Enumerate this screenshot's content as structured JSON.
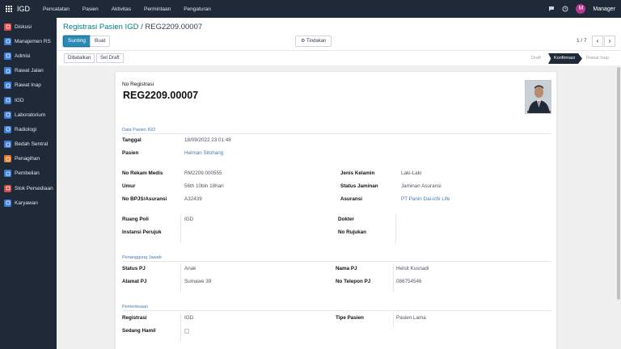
{
  "topbar": {
    "brand": "IGD",
    "menu": [
      "Pencatatan",
      "Pasien",
      "Aktivitas",
      "Permintaan",
      "Pengaturan"
    ],
    "user_initial": "M",
    "user_name": "Manager"
  },
  "sidebar": {
    "items": [
      {
        "label": "Diskusi",
        "icon": "chat-icon",
        "color": "#e14d4d"
      },
      {
        "label": "Manajemen RS",
        "icon": "hospital-icon",
        "color": "#3b7dd8"
      },
      {
        "label": "Admisi",
        "icon": "admission-icon",
        "color": "#3b7dd8"
      },
      {
        "label": "Rawat Jalan",
        "icon": "outpatient-icon",
        "color": "#3b7dd8"
      },
      {
        "label": "Rawat Inap",
        "icon": "bed-icon",
        "color": "#3b7dd8"
      },
      {
        "label": "IGD",
        "icon": "emergency-icon",
        "color": "#3b7dd8"
      },
      {
        "label": "Laboratorium",
        "icon": "lab-icon",
        "color": "#3b7dd8"
      },
      {
        "label": "Radiologi",
        "icon": "radiology-icon",
        "color": "#3b7dd8"
      },
      {
        "label": "Bedah Sentral",
        "icon": "surgery-icon",
        "color": "#3b7dd8"
      },
      {
        "label": "Penagihan",
        "icon": "invoice-icon",
        "color": "#e07b2e"
      },
      {
        "label": "Pembelian",
        "icon": "purchase-icon",
        "color": "#3b7dd8"
      },
      {
        "label": "Stok Persediaan",
        "icon": "stock-icon",
        "color": "#c84a4a"
      },
      {
        "label": "Karyawan",
        "icon": "employees-icon",
        "color": "#3b7dd8"
      }
    ]
  },
  "control": {
    "breadcrumb_parent": "Registrasi Pasien IGD",
    "breadcrumb_sep": " / ",
    "breadcrumb_current": "REG2209.00007",
    "edit_label": "Sunting",
    "create_label": "Buat",
    "action_label": "Tindakan",
    "pager": "1 / 7"
  },
  "statusbar": {
    "cancel_label": "Dibatalkan",
    "draft_btn_label": "Set Draft",
    "stages": [
      "Draft",
      "Konfirmasi",
      "Rawat Inap"
    ],
    "active_stage": "Konfirmasi"
  },
  "form": {
    "no_reg_label": "No Registrasi",
    "no_reg_value": "REG2209.00007",
    "section_patient": "Data Pasien IGD",
    "tanggal_label": "Tanggal",
    "tanggal_value": "18/09/2022 23:01:48",
    "pasien_label": "Pasien",
    "pasien_value": "Helman Sitohang",
    "rekam_medis_label": "No Rekam Medis",
    "rekam_medis_value": "RM2209.000555",
    "umur_label": "Umur",
    "umur_value": "56th 10bln 18hari",
    "bpjs_label": "No BPJS/Asuransi",
    "bpjs_value": "A32439",
    "jk_label": "Jenis Kelamin",
    "jk_value": "Laki-Laki",
    "jaminan_label": "Status Jaminan",
    "jaminan_value": "Jaminan Asuransi",
    "asuransi_label": "Asuransi",
    "asuransi_value": "PT Panin Dai-ichi Life",
    "ruang_label": "Ruang Poli",
    "ruang_value": "IGD",
    "instansi_label": "Instansi Perujuk",
    "instansi_value": "",
    "dokter_label": "Dokter",
    "dokter_value": "",
    "rujukan_label": "No Rujukan",
    "rujukan_value": "",
    "section_pj": "Penanggung Jawab",
    "status_pj_label": "Status PJ",
    "status_pj_value": "Anak",
    "alamat_pj_label": "Alamat PJ",
    "alamat_pj_value": "Sumawe 39",
    "nama_pj_label": "Nama PJ",
    "nama_pj_value": "Helsit Kusnadi",
    "telp_pj_label": "No Telepon PJ",
    "telp_pj_value": "086754546",
    "section_exam": "Pemeriksaan",
    "registrasi_label": "Registrasi",
    "registrasi_value": "IGD",
    "hamil_label": "Sedang Hamil",
    "tipe_label": "Tipe Pasien",
    "tipe_value": "Pasien Lama"
  }
}
